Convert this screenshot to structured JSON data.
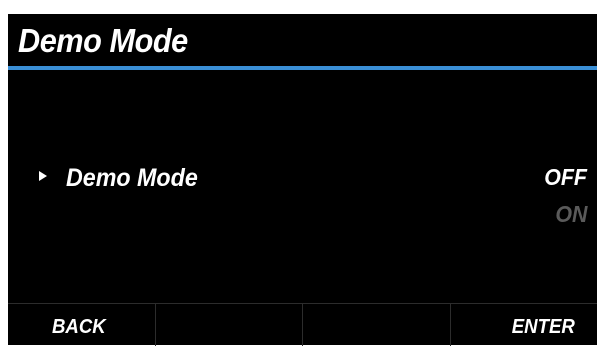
{
  "screen": {
    "title": "Demo Mode",
    "accent_color": "#3a8fd6"
  },
  "setting": {
    "cursor_icon": "right-triangle-icon",
    "label": "Demo Mode",
    "options": [
      "OFF",
      "ON"
    ],
    "selected": "OFF"
  },
  "softkeys": {
    "back_label": "BACK",
    "enter_label": "ENTER",
    "slot2_label": "",
    "slot3_label": ""
  }
}
